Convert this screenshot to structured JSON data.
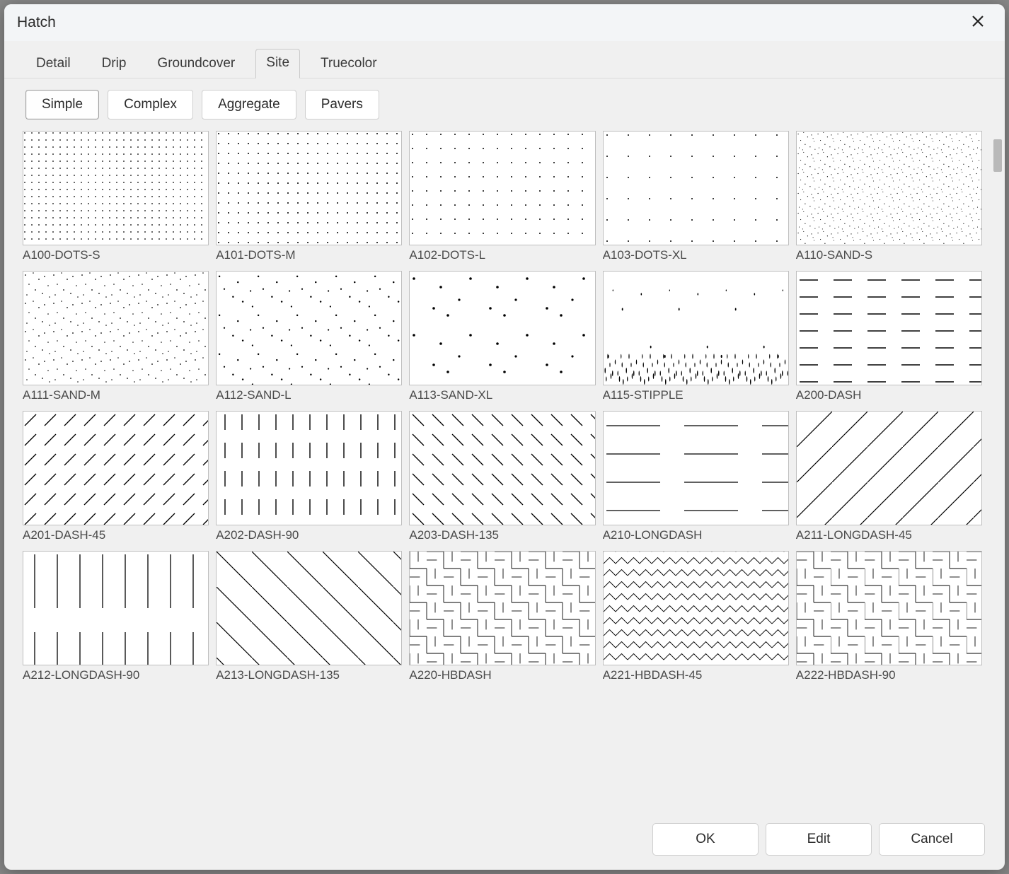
{
  "title": "Hatch",
  "tabs": [
    {
      "label": "Detail",
      "active": false
    },
    {
      "label": "Drip",
      "active": false
    },
    {
      "label": "Groundcover",
      "active": false
    },
    {
      "label": "Site",
      "active": true
    },
    {
      "label": "Truecolor",
      "active": false
    }
  ],
  "subtabs": [
    {
      "label": "Simple",
      "active": true
    },
    {
      "label": "Complex",
      "active": false
    },
    {
      "label": "Aggregate",
      "active": false
    },
    {
      "label": "Pavers",
      "active": false
    }
  ],
  "patterns": [
    {
      "name": "A100-DOTS-S",
      "cls": "pat-dots-s"
    },
    {
      "name": "A101-DOTS-M",
      "cls": "pat-dots-m"
    },
    {
      "name": "A102-DOTS-L",
      "cls": "pat-dots-l"
    },
    {
      "name": "A103-DOTS-XL",
      "cls": "pat-dots-xl"
    },
    {
      "name": "A110-SAND-S",
      "cls": "pat-sand-s"
    },
    {
      "name": "A111-SAND-M",
      "cls": "pat-sand-m"
    },
    {
      "name": "A112-SAND-L",
      "cls": "pat-sand-l"
    },
    {
      "name": "A113-SAND-XL",
      "cls": "pat-sand-xl"
    },
    {
      "name": "A115-STIPPLE",
      "cls": "pat-stipple"
    },
    {
      "name": "A200-DASH",
      "cls": "pat-dash"
    },
    {
      "name": "A201-DASH-45",
      "cls": "pat-dash-45"
    },
    {
      "name": "A202-DASH-90",
      "cls": "pat-dash-90"
    },
    {
      "name": "A203-DASH-135",
      "cls": "pat-dash-135"
    },
    {
      "name": "A210-LONGDASH",
      "cls": "pat-longdash"
    },
    {
      "name": "A211-LONGDASH-45",
      "cls": "pat-longdash-45"
    },
    {
      "name": "A212-LONGDASH-90",
      "cls": "pat-longdash-90"
    },
    {
      "name": "A213-LONGDASH-135",
      "cls": "pat-longdash-135"
    },
    {
      "name": "A220-HBDASH",
      "cls": "pat-hbdash"
    },
    {
      "name": "A221-HBDASH-45",
      "cls": "pat-hbdash-45"
    },
    {
      "name": "A222-HBDASH-90",
      "cls": "pat-hbdash-90"
    }
  ],
  "buttons": {
    "ok": "OK",
    "edit": "Edit",
    "cancel": "Cancel"
  }
}
